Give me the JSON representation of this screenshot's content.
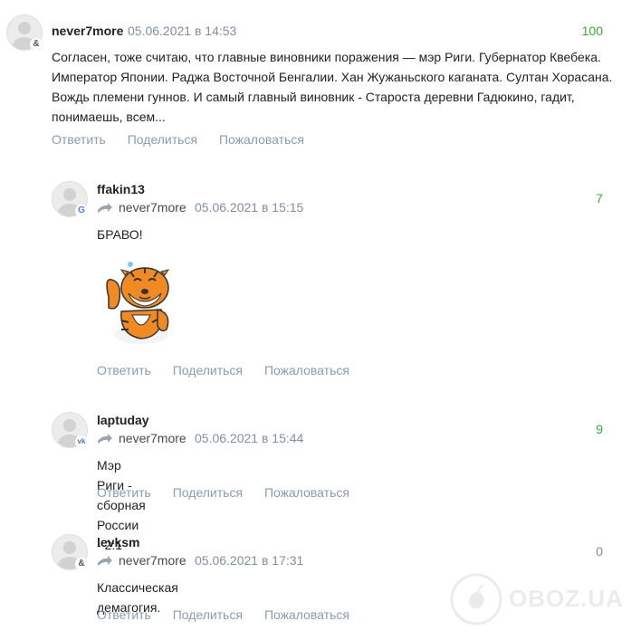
{
  "actions": {
    "reply": "Ответить",
    "share": "Поделиться",
    "report": "Пожаловаться"
  },
  "comments": [
    {
      "author": "never7more",
      "date": "05.06.2021 в 14:53",
      "rating": "100",
      "text_lines": [
        "Согласен, тоже считаю, что главные виновники поражения — мэр Риги. Губернатор Квебека.",
        "Император Японии. Раджа Восточной Бенгалии. Хан Жужаньского каганата. Султан Хорасана.",
        "Вождь племени гуннов. И самый главный виновник - Староста деревни Гадюкино, гадит,",
        "понимаешь, всем..."
      ],
      "badge": "&"
    },
    {
      "author": "ffakin13",
      "reply_to": "never7more",
      "date": "05.06.2021 в 15:15",
      "rating": "7",
      "text": "БРАВО!",
      "badge": "G"
    },
    {
      "author": "laptuday",
      "reply_to": "never7more",
      "date": "05.06.2021 в 15:44",
      "rating": "9",
      "text": "Мэр Риги - сборная России - 2:1",
      "badge": "vk"
    },
    {
      "author": "levksm",
      "reply_to": "never7more",
      "date": "05.06.2021 в 17:31",
      "rating": "0",
      "text": "Классическая демагогия.",
      "badge": "&"
    }
  ],
  "watermark": "OBOZ.UA"
}
